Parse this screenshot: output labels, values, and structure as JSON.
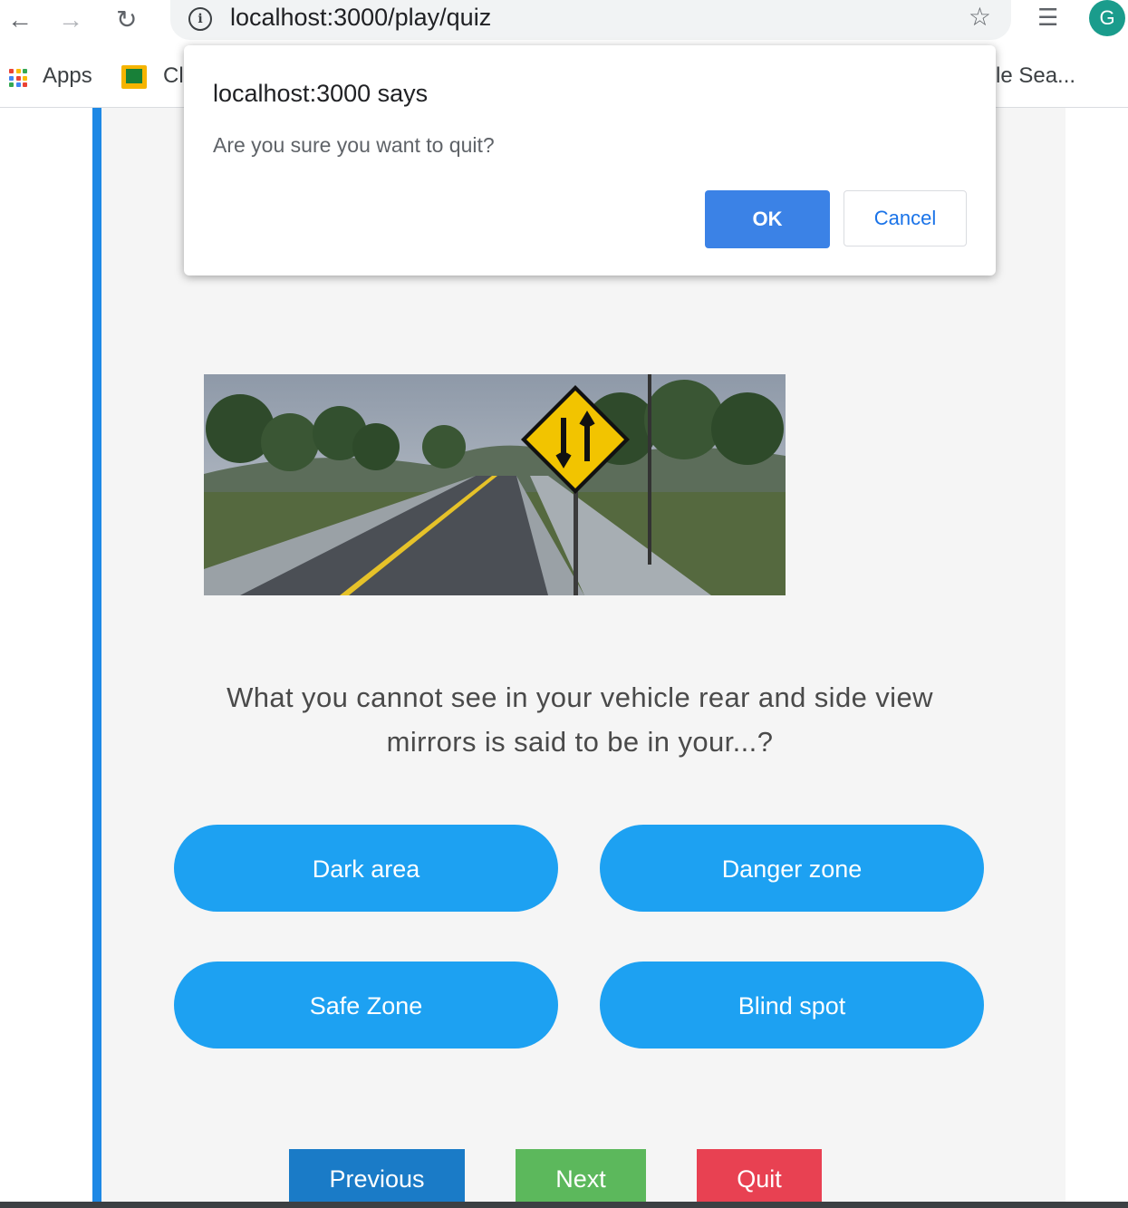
{
  "browser": {
    "url": "localhost:3000/play/quiz",
    "avatar_letter": "G",
    "bookmarks": {
      "apps_label": "Apps",
      "item2_label": "Cl",
      "item3_label": "le Sea..."
    }
  },
  "dialog": {
    "title": "localhost:3000 says",
    "message": "Are you sure you want to quit?",
    "ok_label": "OK",
    "cancel_label": "Cancel"
  },
  "quiz": {
    "question": "What you cannot see in your vehicle rear and side view mirrors is said to be in your...?",
    "options": [
      "Dark area",
      "Danger zone",
      "Safe Zone",
      "Blind spot"
    ],
    "buttons": {
      "previous": "Previous",
      "next": "Next",
      "quit": "Quit"
    }
  },
  "colors": {
    "accent": "#1da1f2",
    "previous": "#1a7bc7",
    "next": "#5cb85c",
    "quit": "#e84152"
  }
}
